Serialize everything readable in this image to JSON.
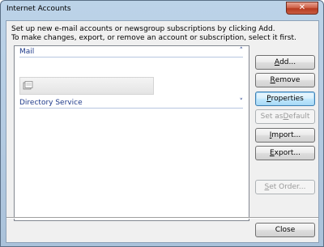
{
  "window": {
    "title": "Internet Accounts",
    "close_glyph": "✕"
  },
  "instructions": {
    "line1": "Set up new e-mail accounts or newsgroup subscriptions by clicking Add.",
    "line2": "To make changes, export, or remove an account or subscription, select it first."
  },
  "accounts_list": {
    "groups": [
      {
        "label": "Mail",
        "chevron": "˄",
        "expanded": true
      },
      {
        "label": "Directory Service",
        "chevron": "˅",
        "expanded": false
      }
    ],
    "mail_item_icon": "mail-account-icon"
  },
  "buttons": {
    "add": {
      "pre": "",
      "key": "A",
      "post": "dd..."
    },
    "remove": {
      "pre": "",
      "key": "R",
      "post": "emove"
    },
    "properties": {
      "pre": "",
      "key": "P",
      "post": "roperties"
    },
    "set_default": {
      "pre": "Set as ",
      "key": "D",
      "post": "efault"
    },
    "import": {
      "pre": "",
      "key": "I",
      "post": "mport..."
    },
    "export": {
      "pre": "",
      "key": "E",
      "post": "xport..."
    },
    "set_order": {
      "pre": "",
      "key": "S",
      "post": "et Order..."
    },
    "close": "Close"
  },
  "colors": {
    "group_header": "#1e3a8a",
    "close_button": "#c85c42"
  }
}
